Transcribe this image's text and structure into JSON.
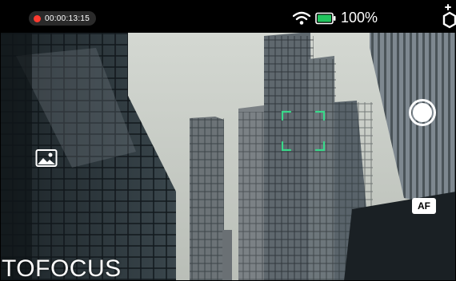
{
  "status": {
    "recording_time": "00:00:13:15",
    "battery_text": "100%"
  },
  "controls": {
    "af_label": "AF"
  },
  "mode": {
    "label": "TOFOCUS"
  },
  "icons": {
    "rec": "record-dot-icon",
    "wifi": "wifi-icon",
    "battery": "battery-icon",
    "corner": "settings-badge-icon",
    "gallery": "image-gallery-icon",
    "shutter": "shutter-icon",
    "focus": "focus-frame-icon"
  },
  "colors": {
    "rec_red": "#ff3b30",
    "battery_green": "#22c55e",
    "focus_green": "#39d98a",
    "sky": "#c9cdc8"
  }
}
